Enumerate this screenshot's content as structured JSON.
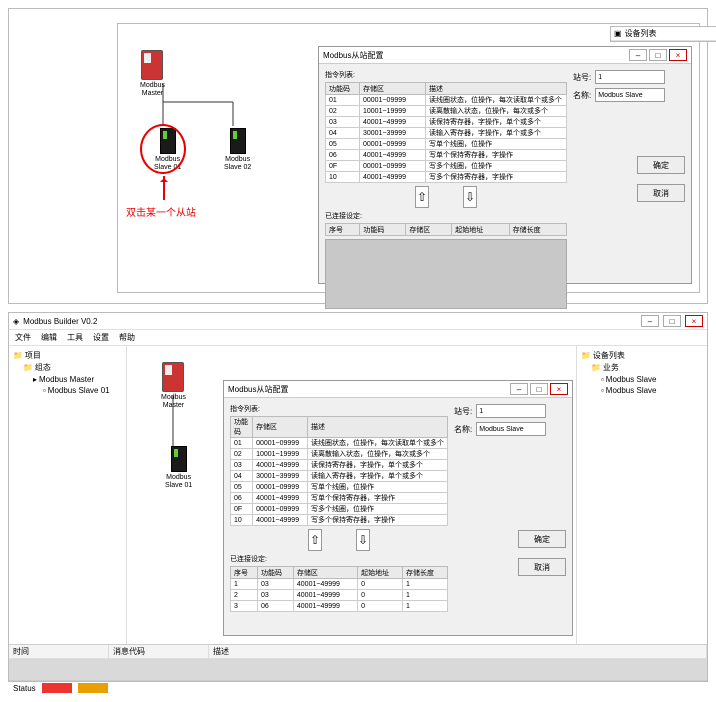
{
  "devlist_window_title": "设备列表",
  "devlist_groups": [
    "业务"
  ],
  "devlist_items": [
    "Modbus Slave"
  ],
  "dialog_title": "Modbus从站配置",
  "section_instr": "指令列表:",
  "section_added": "已连接设定:",
  "instr_cols": [
    "功能码",
    "存储区",
    "描述"
  ],
  "instr_rows": [
    {
      "c0": "01",
      "c1": "00001~09999",
      "c2": "读线圈状态，位操作，每次读取单个或多个"
    },
    {
      "c0": "02",
      "c1": "10001~19999",
      "c2": "读离散输入状态，位操作，每次或多个"
    },
    {
      "c0": "03",
      "c1": "40001~49999",
      "c2": "读保持寄存器，字操作，单个或多个"
    },
    {
      "c0": "04",
      "c1": "30001~39999",
      "c2": "读输入寄存器，字操作，单个或多个"
    },
    {
      "c0": "05",
      "c1": "00001~09999",
      "c2": "写单个线圈，位操作"
    },
    {
      "c0": "06",
      "c1": "40001~49999",
      "c2": "写单个保持寄存器，字操作"
    },
    {
      "c0": "0F",
      "c1": "00001~09999",
      "c2": "写多个线圈，位操作"
    },
    {
      "c0": "10",
      "c1": "40001~49999",
      "c2": "写多个保持寄存器，字操作"
    }
  ],
  "added_cols": [
    "序号",
    "功能码",
    "存储区",
    "起始地址",
    "存储长度"
  ],
  "added_rows_panel2": [
    {
      "c0": "1",
      "c1": "03",
      "c2": "40001~49999",
      "c3": "0",
      "c4": "1"
    },
    {
      "c0": "2",
      "c1": "03",
      "c2": "40001~49999",
      "c3": "0",
      "c4": "1"
    },
    {
      "c0": "3",
      "c1": "06",
      "c2": "40001~49999",
      "c3": "0",
      "c4": "1"
    }
  ],
  "form_stationNo_label": "站号:",
  "form_stationNo_value": "1",
  "form_name_label": "名称:",
  "form_name_value": "Modbus Slave",
  "btn_ok": "确定",
  "btn_cancel": "取消",
  "master_label": "Modbus\nMaster",
  "slave1_label": "Modbus\nSlave 01",
  "slave2_label": "Modbus\nSlave 02",
  "annot_text": "双击某一个从站",
  "app_title": "Modbus Builder V0.2",
  "menu_items": [
    "文件",
    "编辑",
    "工具",
    "设置",
    "帮助"
  ],
  "tree_root": "项目",
  "tree_group": "组态",
  "tree_master": "Modbus Master",
  "tree_slave1": "Modbus Slave 01",
  "devlist_root": "设备列表",
  "devlist_group2": "业务",
  "devlist_slave": "Modbus Slave",
  "log_cols": [
    "时间",
    "消息代码",
    "描述"
  ],
  "status_label": "Status"
}
